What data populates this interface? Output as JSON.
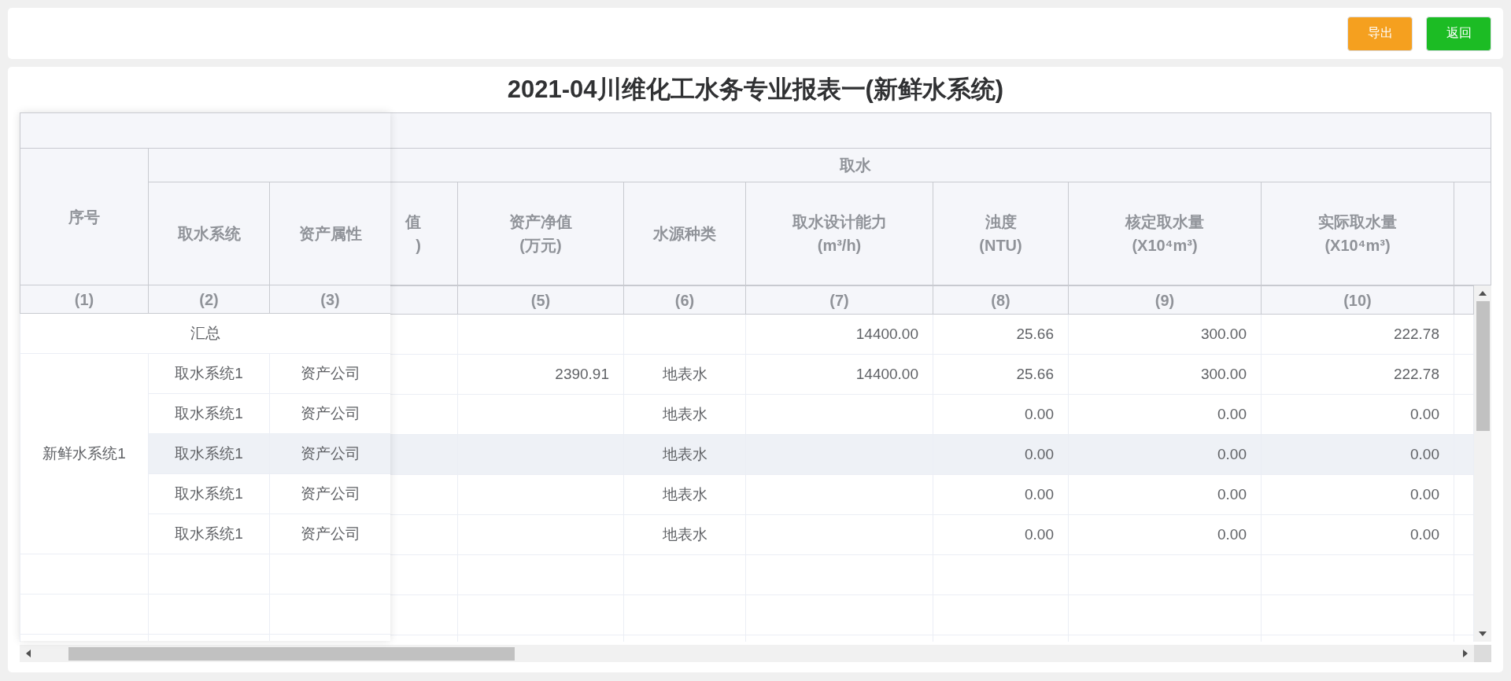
{
  "toolbar": {
    "buttons": [
      {
        "label": "导出",
        "kind": "export"
      },
      {
        "label": "返回",
        "kind": "back"
      }
    ]
  },
  "report": {
    "title": "2021-04川维化工水务专业报表一(新鲜水系统)",
    "table": {
      "group_header": "取水",
      "fixed_columns": [
        {
          "header": "序号",
          "index": "(1)"
        },
        {
          "header": "取水系统",
          "index": "(2)"
        },
        {
          "header": "资产属性",
          "index": "(3)"
        }
      ],
      "columns": [
        {
          "header": [
            "值",
            ")"
          ],
          "kind": "number"
        },
        {
          "header": [
            "资产净值",
            "(万元)"
          ],
          "index": "(5)",
          "kind": "number"
        },
        {
          "header": [
            "水源种类"
          ],
          "index": "(6)",
          "kind": "text"
        },
        {
          "header": [
            "取水设计能力",
            "(m³/h)"
          ],
          "index": "(7)",
          "kind": "number"
        },
        {
          "header": [
            "浊度",
            "(NTU)"
          ],
          "index": "(8)",
          "kind": "number"
        },
        {
          "header": [
            "核定取水量",
            "(X10⁴m³)"
          ],
          "index": "(9)",
          "kind": "number"
        },
        {
          "header": [
            "实际取水量",
            "(X10⁴m³)"
          ],
          "index": "(10)",
          "kind": "number"
        }
      ],
      "rows": [
        {
          "kind": "summary",
          "label": "汇总",
          "cells": [
            null,
            null,
            null,
            "14400.00",
            "25.66",
            "300.00",
            "222.78"
          ]
        },
        {
          "kind": "group",
          "name": "新鲜水系统1",
          "rows": [
            {
              "system": "取水系统1",
              "attribute": "资产公司",
              "hovered": false,
              "cells": [
                null,
                "2390.91",
                "地表水",
                "14400.00",
                "25.66",
                "300.00",
                "222.78"
              ]
            },
            {
              "system": "取水系统1",
              "attribute": "资产公司",
              "hovered": false,
              "cells": [
                null,
                null,
                "地表水",
                null,
                "0.00",
                "0.00",
                "0.00"
              ]
            },
            {
              "system": "取水系统1",
              "attribute": "资产公司",
              "hovered": true,
              "cells": [
                null,
                null,
                "地表水",
                null,
                "0.00",
                "0.00",
                "0.00"
              ]
            },
            {
              "system": "取水系统1",
              "attribute": "资产公司",
              "hovered": false,
              "cells": [
                null,
                null,
                "地表水",
                null,
                "0.00",
                "0.00",
                "0.00"
              ]
            },
            {
              "system": "取水系统1",
              "attribute": "资产公司",
              "hovered": false,
              "cells": [
                null,
                null,
                "地表水",
                null,
                "0.00",
                "0.00",
                "0.00"
              ]
            }
          ]
        }
      ]
    }
  }
}
